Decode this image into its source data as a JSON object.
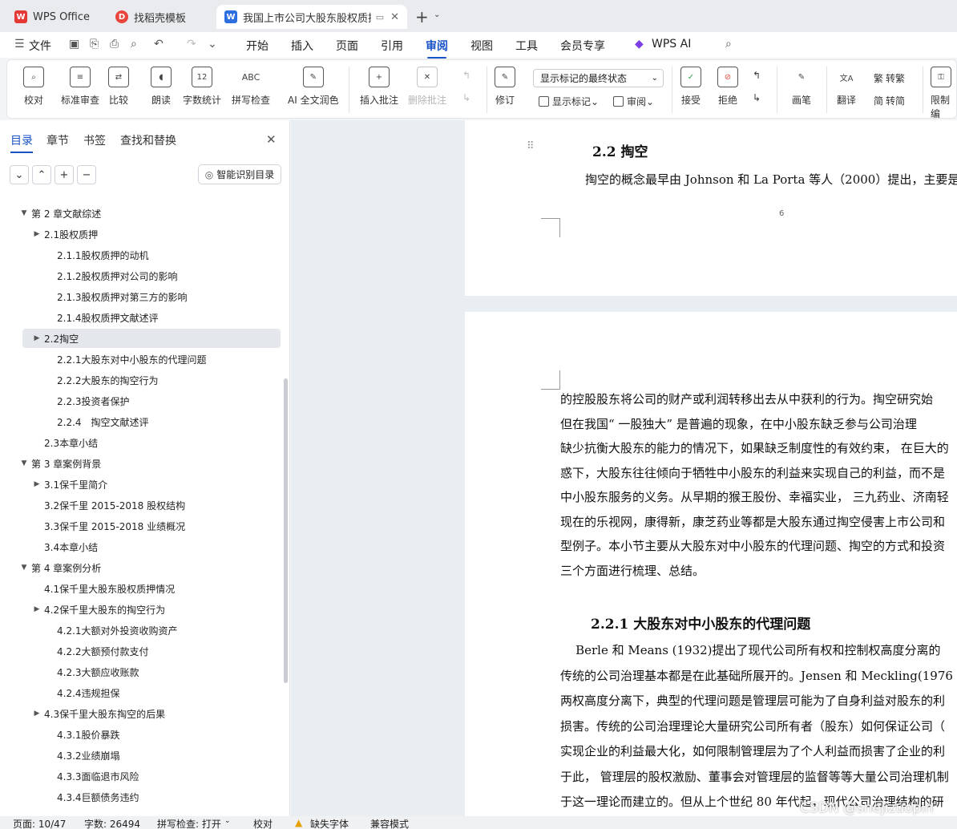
{
  "tabs": [
    {
      "label": "WPS Office"
    },
    {
      "label": "找稻壳模板"
    },
    {
      "label": "我国上市公司大股东股权质押"
    }
  ],
  "menu": {
    "file": "文件",
    "items": [
      "开始",
      "插入",
      "页面",
      "引用",
      "审阅",
      "视图",
      "工具",
      "会员专享"
    ],
    "ai": "WPS AI",
    "active": "审阅"
  },
  "ribbon": {
    "buttons": [
      "校对",
      "标准审查",
      "比较",
      "朗读",
      "字数统计",
      "拼写检查",
      "AI 全文润色",
      "插入批注",
      "删除批注",
      "修订",
      "画笔",
      "接受",
      "拒绝",
      "翻译",
      "限制编"
    ],
    "display_select": "显示标记的最终状态",
    "show_marks": "显示标记",
    "review": "审阅",
    "to_trad": "转繁",
    "to_simp": "转简",
    "icon_label_wordcount": "12",
    "icon_label_spell": "ABC"
  },
  "panel": {
    "tabs": [
      "目录",
      "章节",
      "书签",
      "查找和替换"
    ],
    "smart": "智能识别目录",
    "toc": [
      {
        "text": "第 2 章文献综述",
        "level": 1,
        "arrow": "▼"
      },
      {
        "text": "2.1股权质押",
        "level": 2,
        "arrow": "▶"
      },
      {
        "text": "2.1.1股权质押的动机",
        "level": 3,
        "arrow": ""
      },
      {
        "text": "2.1.2股权质押对公司的影响",
        "level": 3,
        "arrow": ""
      },
      {
        "text": "2.1.3股权质押对第三方的影响",
        "level": 3,
        "arrow": ""
      },
      {
        "text": "2.1.4股权质押文献述评",
        "level": 3,
        "arrow": ""
      },
      {
        "text": "2.2掏空",
        "level": 2,
        "arrow": "▶",
        "highlight": true
      },
      {
        "text": "2.2.1大股东对中小股东的代理问题",
        "level": 3,
        "arrow": ""
      },
      {
        "text": "2.2.2大股东的掏空行为",
        "level": 3,
        "arrow": ""
      },
      {
        "text": "2.2.3投资者保护",
        "level": 3,
        "arrow": ""
      },
      {
        "text": "2.2.4　掏空文献述评",
        "level": 3,
        "arrow": ""
      },
      {
        "text": "2.3本章小结",
        "level": 2,
        "arrow": ""
      },
      {
        "text": "第 3 章案例背景",
        "level": 1,
        "arrow": "▼"
      },
      {
        "text": "3.1保千里简介",
        "level": 2,
        "arrow": "▶"
      },
      {
        "text": "3.2保千里 2015-2018 股权结构",
        "level": 2,
        "arrow": ""
      },
      {
        "text": "3.3保千里 2015-2018 业绩概况",
        "level": 2,
        "arrow": ""
      },
      {
        "text": "3.4本章小结",
        "level": 2,
        "arrow": ""
      },
      {
        "text": "第 4 章案例分析",
        "level": 1,
        "arrow": "▼"
      },
      {
        "text": "4.1保千里大股东股权质押情况",
        "level": 2,
        "arrow": ""
      },
      {
        "text": "4.2保千里大股东的掏空行为",
        "level": 2,
        "arrow": "▶"
      },
      {
        "text": "4.2.1大额对外投资收购资产",
        "level": 3,
        "arrow": ""
      },
      {
        "text": "4.2.2大额预付款支付",
        "level": 3,
        "arrow": ""
      },
      {
        "text": "4.2.3大额应收账款",
        "level": 3,
        "arrow": ""
      },
      {
        "text": "4.2.4违规担保",
        "level": 3,
        "arrow": ""
      },
      {
        "text": "4.3保千里大股东掏空的后果",
        "level": 2,
        "arrow": "▶"
      },
      {
        "text": "4.3.1股价暴跌",
        "level": 3,
        "arrow": ""
      },
      {
        "text": "4.3.2业绩崩塌",
        "level": 3,
        "arrow": ""
      },
      {
        "text": "4.3.3面临退市风险",
        "level": 3,
        "arrow": ""
      },
      {
        "text": "4.3.4巨额债务违约",
        "level": 3,
        "arrow": ""
      }
    ]
  },
  "doc": {
    "heading1": "2.2  掏空",
    "line1": "掏空的概念最早由 Johnson 和 La Porta 等人（2000）提出，主要是",
    "page_no": "6",
    "para": [
      "的控股股东将公司的财产或利润转移出去从中获利的行为。掏空研究始",
      "但在我国“ 一股独大” 是普遍的现象，在中小股东缺乏参与公司治理",
      "缺少抗衡大股东的能力的情况下，如果缺乏制度性的有效约束， 在巨大的",
      "惑下，大股东往往倾向于牺牲中小股东的利益来实现自己的利益，而不是",
      "中小股东服务的义务。从早期的猴王股份、幸福实业， 三九药业、济南轻",
      "现在的乐视网，康得新，康芝药业等都是大股东通过掏空侵害上市公司和",
      "型例子。本小节主要从大股东对中小股东的代理问题、掏空的方式和投资",
      "三个方面进行梳理、总结。"
    ],
    "heading2": "2.2.1  大股东对中小股东的代理问题",
    "para2": [
      "    Berle 和 Means (1932)提出了现代公司所有权和控制权高度分离的",
      "传统的公司治理基本都是在此基础所展开的。Jensen 和 Meckling(1976",
      "两权高度分离下，典型的代理问题是管理层可能为了自身利益对股东的利",
      "损害。传统的公司治理理论大量研究公司所有者（股东）如何保证公司（",
      "实现企业的利益最大化，如何限制管理层为了个人利益而损害了企业的利",
      "于此， 管理层的股权激励、董事会对管理层的监督等等大量公司治理机制",
      "于这一理论而建立的。但从上个世纪 80 年代起，现代公司治理结构的研"
    ]
  },
  "status": {
    "page": "页面: 10/47",
    "words": "字数: 26494",
    "spell": "拼写检查: 打开",
    "proof": "校对",
    "font": "缺失字体",
    "mode": "兼容模式"
  },
  "watermark": "CSDN @shejizuopin"
}
